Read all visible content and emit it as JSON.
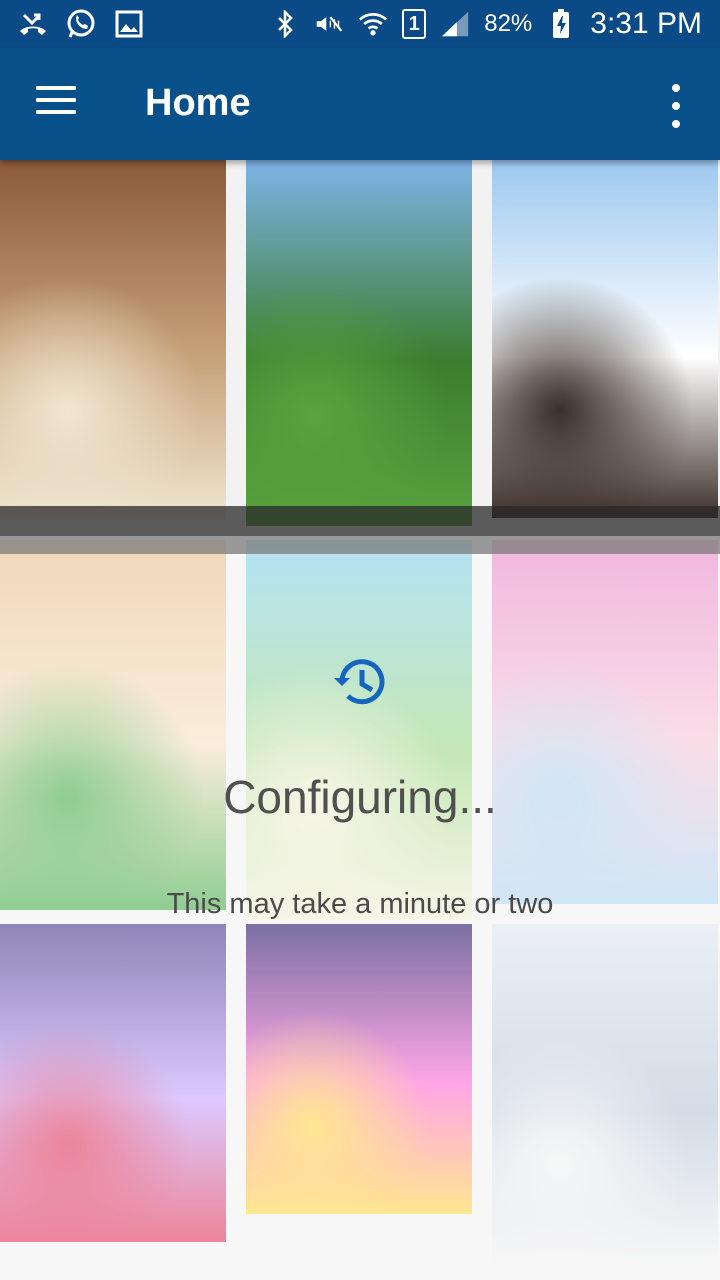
{
  "status_bar": {
    "battery": "82%",
    "time": "3:31 PM",
    "sim": "1",
    "icons": [
      "missed-call-icon",
      "whatsapp-icon",
      "gallery-icon",
      "bluetooth-icon",
      "mute-icon",
      "wifi-icon",
      "sim-icon",
      "signal-icon",
      "battery-charging-icon"
    ]
  },
  "app_bar": {
    "title": "Home",
    "menu_icon": "hamburger-menu-icon",
    "overflow_icon": "overflow-menu-icon"
  },
  "grid": {
    "tiles": [
      {
        "name": "auditorium-event-photo",
        "colors": [
          "#8b5a3a",
          "#c7a27a",
          "#f0e6d0"
        ]
      },
      {
        "name": "tug-of-war-photo",
        "colors": [
          "#7fb3e8",
          "#3a7d2e",
          "#5aa33f"
        ]
      },
      {
        "name": "confetti-celebration-photo",
        "colors": [
          "#9cc8f0",
          "#ffffff",
          "#3b2f2a"
        ]
      },
      {
        "name": "martial-arts-kids-photo",
        "colors": [
          "#e8c08f",
          "#f7e2c4",
          "#4caf50"
        ]
      },
      {
        "name": "zero-waste-school-event-poster",
        "colors": [
          "#87d0f0",
          "#9fd98a",
          "#f4f0d8"
        ]
      },
      {
        "name": "students-smiling-photo",
        "colors": [
          "#e98bc9",
          "#f7c9d9",
          "#b4d8f0"
        ]
      },
      {
        "name": "stage-performance-photo",
        "colors": [
          "#4b3b8c",
          "#c6a8ff",
          "#e23b5c"
        ]
      },
      {
        "name": "dance-show-photo",
        "colors": [
          "#2a1a6b",
          "#ff6fd8",
          "#ffd84d"
        ]
      },
      {
        "name": "craft-workshop-photo",
        "colors": [
          "#dfe6ef",
          "#b9c7d8",
          "#f2f2f2"
        ]
      }
    ]
  },
  "overlay": {
    "icon": "history-clock-icon",
    "title": "Configuring...",
    "subtitle": "This may take a minute or two",
    "accent": "#1565c0"
  }
}
